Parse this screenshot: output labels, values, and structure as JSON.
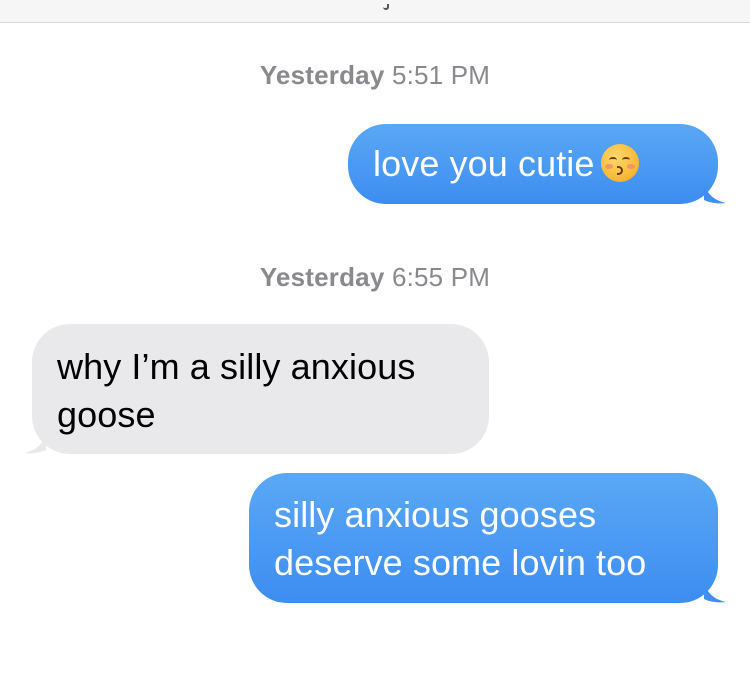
{
  "header": {
    "clipped_text": "y"
  },
  "conversation": {
    "timestamps": [
      {
        "day": "Yesterday",
        "time": "5:51 PM"
      },
      {
        "day": "Yesterday",
        "time": "6:55 PM"
      }
    ],
    "messages": [
      {
        "direction": "sent",
        "text": "love you cutie",
        "emoji": "kissing-face-with-closed-eyes"
      },
      {
        "direction": "received",
        "text": "why I’m a silly anxious goose"
      },
      {
        "direction": "sent",
        "text": "silly anxious gooses deserve some lovin too"
      }
    ]
  },
  "colors": {
    "sent_bubble": "#4a9af4",
    "received_bubble": "#e9e9eb",
    "timestamp_text": "#8a8a8e",
    "sent_text": "#ffffff",
    "received_text": "#000000"
  }
}
